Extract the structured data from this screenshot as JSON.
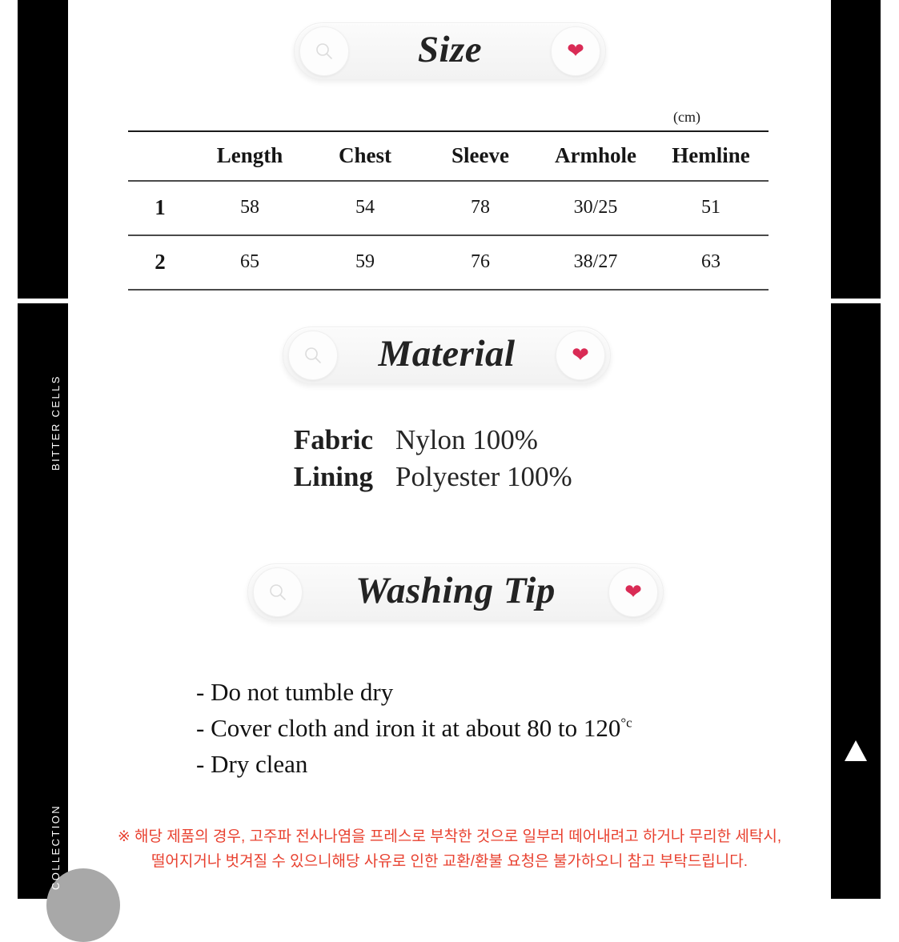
{
  "frame": {
    "brand_label": "BITTER CELLS",
    "collection_label": "COLLECTION",
    "scroll_top_icon": "triangle-up-icon",
    "accent_color": "#d92b55",
    "notice_color": "#e8402f",
    "rail_color": "#000000"
  },
  "sections": {
    "size": {
      "title": "Size",
      "search_icon": "search-icon",
      "favorite_icon": "heart-icon",
      "unit": "(cm)",
      "columns": [
        "",
        "Length",
        "Chest",
        "Sleeve",
        "Armhole",
        "Hemline"
      ],
      "rows": [
        {
          "key": "1",
          "values": [
            "58",
            "54",
            "78",
            "30/25",
            "51"
          ]
        },
        {
          "key": "2",
          "values": [
            "65",
            "59",
            "76",
            "38/27",
            "63"
          ]
        }
      ]
    },
    "material": {
      "title": "Material",
      "search_icon": "search-icon",
      "favorite_icon": "heart-icon",
      "rows": [
        {
          "label": "Fabric",
          "value": "Nylon 100%"
        },
        {
          "label": "Lining",
          "value": "Polyester 100%"
        }
      ]
    },
    "washing": {
      "title": "Washing Tip",
      "search_icon": "search-icon",
      "favorite_icon": "heart-icon",
      "tips": [
        "- Do not tumble dry",
        "- Cover cloth and iron it at about 80 to 120",
        "- Dry clean"
      ],
      "temperature_unit": "°c"
    }
  },
  "notice": {
    "line1": "※ 해당 제품의 경우, 고주파 전사나염을 프레스로 부착한 것으로 일부러 떼어내려고 하거나 무리한 세탁시,",
    "line2": "떨어지거나 벗겨질 수 있으니해당 사유로 인한 교환/환불 요청은 불가하오니 참고 부탁드립니다."
  }
}
